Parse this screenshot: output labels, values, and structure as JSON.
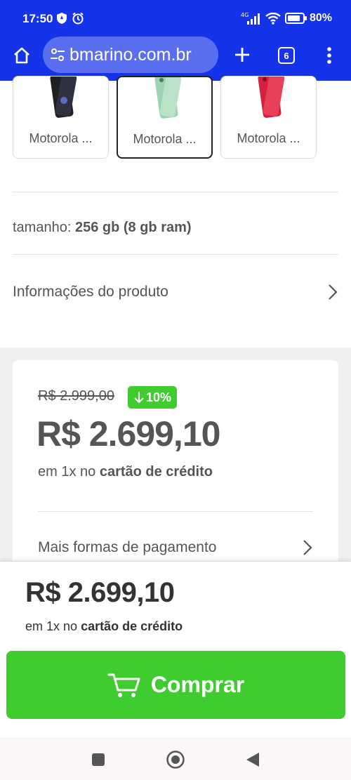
{
  "status_bar": {
    "time": "17:50",
    "battery_percent": "80%",
    "network": "4G"
  },
  "browser": {
    "url": "bmarino.com.br",
    "tab_count": "6"
  },
  "variants": [
    {
      "label": "Motorola ...",
      "color": "#1f1f24",
      "selected": false
    },
    {
      "label": "Motorola ...",
      "color": "#9cd3b0",
      "selected": true
    },
    {
      "label": "Motorola ...",
      "color": "#d5213f",
      "selected": false
    }
  ],
  "size": {
    "label": "tamanho:",
    "value": "256 gb (8 gb ram)"
  },
  "product_info": {
    "label": "Informações do produto"
  },
  "price_card": {
    "old_price": "R$ 2.999,00",
    "discount": "10%",
    "price": "R$ 2.699,10",
    "terms_prefix": "em 1x no",
    "terms_bold": "cartão de crédito",
    "more_payment": "Mais formas de pagamento"
  },
  "sticky": {
    "price": "R$ 2.699,10",
    "terms_prefix": "em 1x no",
    "terms_bold": "cartão de crédito",
    "buy_label": "Comprar"
  },
  "colors": {
    "browser_bar": "#1533e8",
    "accent_green": "#3fcc2f",
    "text_grey": "#555555"
  }
}
